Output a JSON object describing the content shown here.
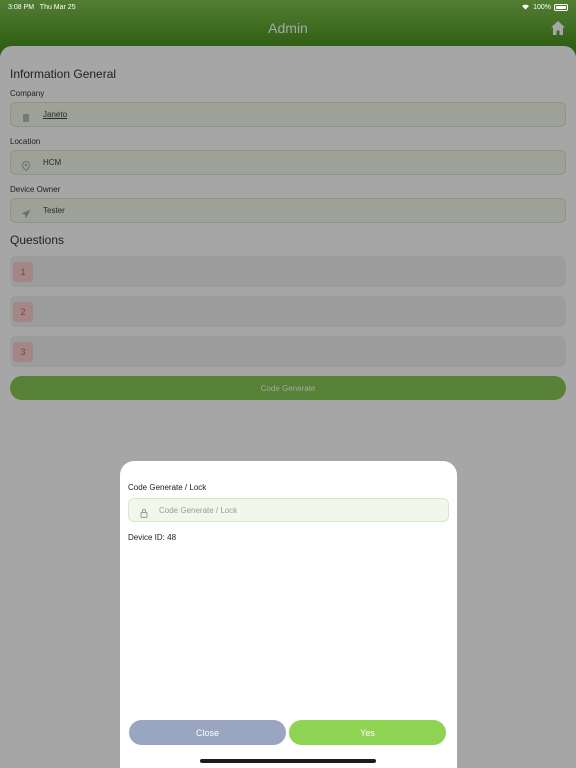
{
  "status_bar": {
    "time": "3:08 PM",
    "date": "Thu Mar 25",
    "battery": "100%"
  },
  "header": {
    "title": "Admin"
  },
  "info_section": {
    "title": "Information General",
    "company": {
      "label": "Company",
      "value": "Janeto"
    },
    "location": {
      "label": "Location",
      "value": "HCM"
    },
    "device_owner": {
      "label": "Device Owner",
      "value": "Tester"
    }
  },
  "questions_section": {
    "title": "Questions",
    "items": [
      {
        "number": "1"
      },
      {
        "number": "2"
      },
      {
        "number": "3"
      }
    ]
  },
  "code_generate_button": {
    "label": "Code Generate"
  },
  "modal": {
    "field_label": "Code Generate / Lock",
    "input_placeholder": "Code Generate / Lock",
    "device_id": "Device ID: 48",
    "close_label": "Close",
    "yes_label": "Yes"
  },
  "colors": {
    "header_top": "#7fc24e",
    "header_bottom": "#3f8a17",
    "accent_green": "#86c653",
    "close_button": "#9aa5c2"
  }
}
